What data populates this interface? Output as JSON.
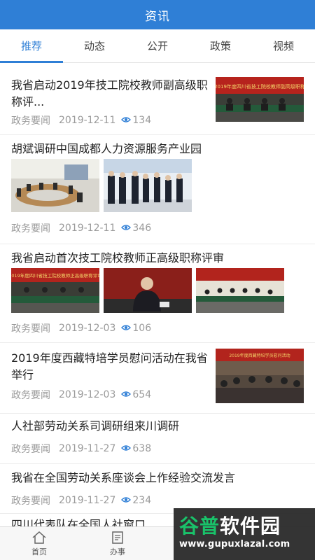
{
  "header": {
    "title": "资讯"
  },
  "tabs": [
    {
      "label": "推荐",
      "active": true
    },
    {
      "label": "动态",
      "active": false
    },
    {
      "label": "公开",
      "active": false
    },
    {
      "label": "政策",
      "active": false
    },
    {
      "label": "视频",
      "active": false
    }
  ],
  "items": [
    {
      "title": "我省启动2019年技工院校教师副高级职称评...",
      "category": "政务要闻",
      "date": "2019-12-11",
      "views": "134",
      "banner_text": "2019年度四川省技工院校教师副高级职称"
    },
    {
      "title": "胡斌调研中国成都人力资源服务产业园",
      "category": "政务要闻",
      "date": "2019-12-11",
      "views": "346"
    },
    {
      "title": "我省启动首次技工院校教师正高级职称评审",
      "category": "政务要闻",
      "date": "2019-12-03",
      "views": "106",
      "banner_text": "2019年度四川省技工院校教师正高级职称评审"
    },
    {
      "title": "2019年度西藏特培学员慰问活动在我省举行",
      "category": "政务要闻",
      "date": "2019-12-03",
      "views": "654",
      "banner_text": "2019年度西藏特培学员慰问活动"
    },
    {
      "title": "人社部劳动关系司调研组来川调研",
      "category": "政务要闻",
      "date": "2019-11-27",
      "views": "638"
    },
    {
      "title": "我省在全国劳动关系座谈会上作经验交流发言",
      "category": "政务要闻",
      "date": "2019-11-27",
      "views": "234"
    },
    {
      "title": "四川代表队在全国人社窗口..."
    }
  ],
  "bottom_nav": [
    {
      "label": "首页",
      "icon": "home-icon"
    },
    {
      "label": "办事",
      "icon": "document-icon"
    }
  ],
  "watermark": {
    "brand_green": "谷普",
    "brand_white": "软件园",
    "url": "www.gupuxlazal.com"
  },
  "colors": {
    "primary": "#2f7fd6",
    "meta_gray": "#9a9a9a"
  }
}
